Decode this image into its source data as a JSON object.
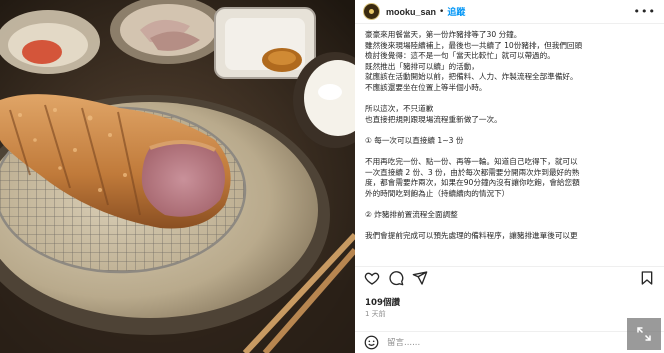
{
  "post": {
    "username": "mooku_san",
    "separator": "•",
    "follow_label": "追蹤",
    "more_label": "•••",
    "caption_lines": [
      "豪豪來用餐當天，第一份炸豬排等了30 分鐘。",
      "雖然後來現場陸續補上，最後也一共續了 10份豬排，但我們回頭",
      "檢討後覺得：這不是一句「當天比較忙」就可以帶過的。",
      "既然推出「豬排可以續」的活動，",
      "就應該在活動開始以前，把備料、人力、炸製流程全部準備好。",
      "不應該還要坐在位置上等半個小時。",
      "",
      "所以這次，不只道歉",
      "也直接把規則跟現場流程重新做了一次。",
      "",
      "① 每一次可以直接續 1~3 份",
      "",
      "不用再吃完一份、點一份、再等一輪。知道自己吃得下，就可以",
      "一次直接續 2 份、3 份，由於每次都需要分開兩次炸到最好的熟",
      "度，都會需要炸兩次，如果在90分鐘內沒有讓你吃飽，會給您額",
      "外的時間吃到飽為止（持續續肉的情況下）",
      "",
      "② 炸豬排前置流程全面調整",
      "",
      "我們會提前完成可以預先處理的備料程序，讓豬排進單後可以更"
    ],
    "likes": "109個讚",
    "time_ago": "1 天前",
    "comment_placeholder": "留言......"
  },
  "icons": {
    "like": "heart-icon",
    "comment": "comment-icon",
    "share": "send-icon",
    "save": "bookmark-icon",
    "emoji": "emoji-icon",
    "expand": "expand-icon"
  },
  "colors": {
    "follow": "#0095f6",
    "text": "#262626",
    "muted": "#8e8e8e"
  }
}
